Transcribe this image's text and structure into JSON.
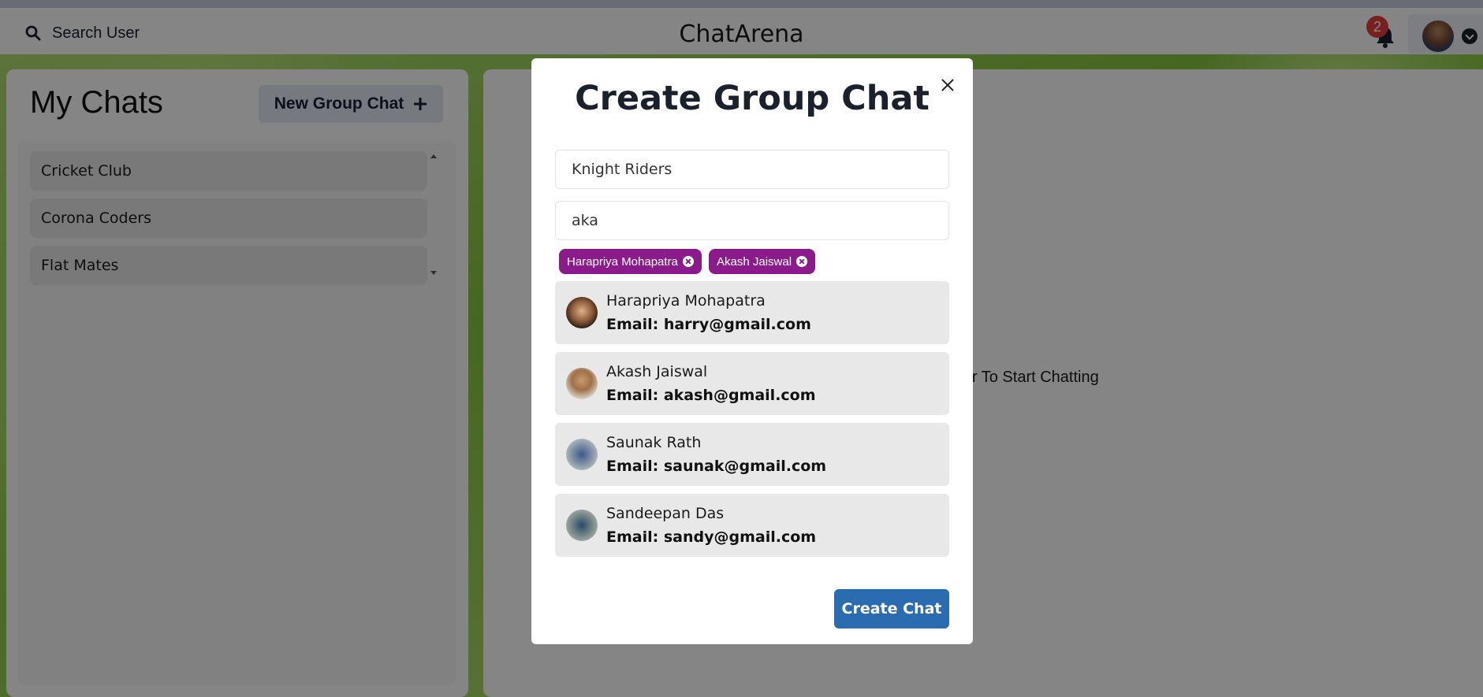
{
  "header": {
    "search_label": "Search User",
    "app_title": "ChatArena",
    "notification_count": "2"
  },
  "my_chats": {
    "title": "My Chats",
    "new_group_label": "New Group Chat",
    "chats": [
      {
        "name": "Cricket Club"
      },
      {
        "name": "Corona Coders"
      },
      {
        "name": "Flat Mates"
      }
    ]
  },
  "chatbox": {
    "hint": "Click on a user To Start Chatting"
  },
  "modal": {
    "title": "Create Group Chat",
    "chat_name_value": "Knight Riders",
    "search_value": "aka",
    "selected_tags": [
      {
        "label": "Harapriya Mohapatra"
      },
      {
        "label": "Akash Jaiswal"
      }
    ],
    "results": [
      {
        "name": "Harapriya Mohapatra",
        "email": "Email: harry@gmail.com"
      },
      {
        "name": "Akash Jaiswal",
        "email": "Email: akash@gmail.com"
      },
      {
        "name": "Saunak Rath",
        "email": "Email: saunak@gmail.com"
      },
      {
        "name": "Sandeepan Das",
        "email": "Email: sandy@gmail.com"
      }
    ],
    "create_label": "Create Chat"
  },
  "colors": {
    "tag_bg": "#8b1a8b",
    "create_button": "#2b6cb0",
    "badge": "#e53e3e"
  }
}
